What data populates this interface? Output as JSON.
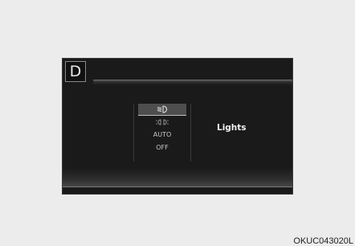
{
  "display": {
    "gear_indicator": "D",
    "title": "Lights",
    "menu": [
      {
        "icon": "low-beam-headlamp-icon",
        "label": "",
        "selected": true
      },
      {
        "icon": "position-lamp-icon",
        "label": "",
        "selected": false
      },
      {
        "label": "AUTO",
        "selected": false
      },
      {
        "label": "OFF",
        "selected": false
      }
    ]
  },
  "figure_code": "OKUC043020L",
  "colors": {
    "screen_bg": "#1a1a1a",
    "page_bg": "#ececec",
    "selected_bg": "#4e4e4e",
    "text": "#f2f2f2"
  }
}
